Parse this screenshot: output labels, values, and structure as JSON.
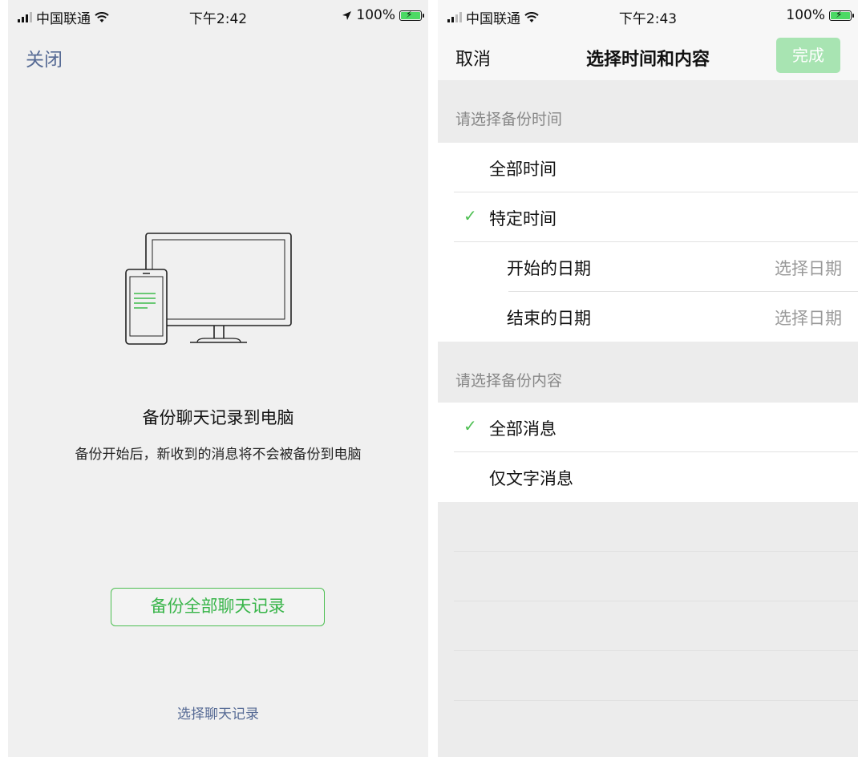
{
  "left": {
    "status": {
      "carrier": "中国联通",
      "time": "下午2:42",
      "battery": "100%"
    },
    "close_label": "关闭",
    "title": "备份聊天记录到电脑",
    "subtitle": "备份开始后，新收到的消息将不会被备份到电脑",
    "backup_all_label": "备份全部聊天记录",
    "select_chat_label": "选择聊天记录"
  },
  "right": {
    "status": {
      "carrier": "中国联通",
      "time": "下午2:43",
      "battery": "100%"
    },
    "nav": {
      "cancel_label": "取消",
      "title": "选择时间和内容",
      "done_label": "完成"
    },
    "time_section": {
      "header": "请选择备份时间",
      "rows": [
        {
          "label": "全部时间",
          "checked": false
        },
        {
          "label": "特定时间",
          "checked": true
        },
        {
          "label": "开始的日期",
          "value": "选择日期"
        },
        {
          "label": "结束的日期",
          "value": "选择日期"
        }
      ]
    },
    "content_section": {
      "header": "请选择备份内容",
      "rows": [
        {
          "label": "全部消息",
          "checked": true
        },
        {
          "label": "仅文字消息",
          "checked": false
        }
      ]
    }
  },
  "colors": {
    "link_blue": "#576b95",
    "wechat_green": "#4dbf52",
    "done_disabled_green": "#a8e4b2",
    "battery_green": "#4cd964"
  },
  "icons": [
    "signal-icon",
    "wifi-icon",
    "location-arrow-icon",
    "battery-charging-icon",
    "checkmark-icon",
    "phone-computer-illustration"
  ]
}
